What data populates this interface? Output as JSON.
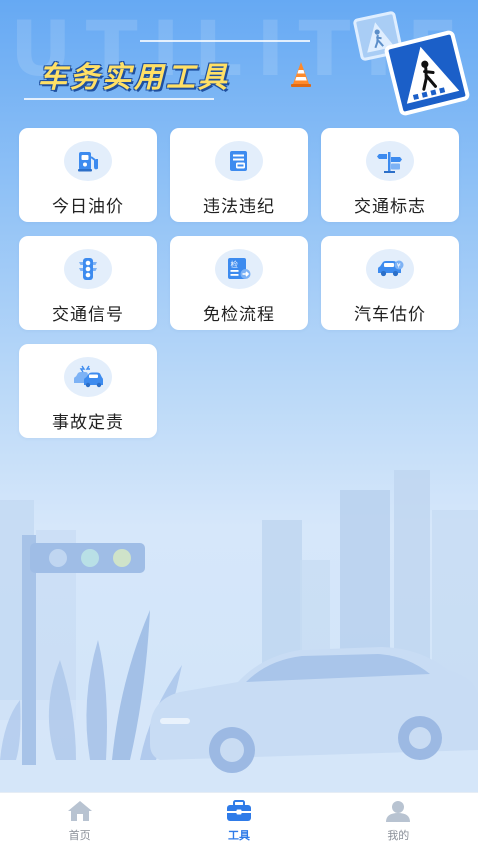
{
  "header": {
    "bg_text": "UTILITIES",
    "title": "车务实用工具"
  },
  "tools": [
    {
      "id": "oil",
      "label": "今日油价",
      "icon": "fuel-pump-icon"
    },
    {
      "id": "violation",
      "label": "违法违纪",
      "icon": "violation-doc-icon"
    },
    {
      "id": "signs",
      "label": "交通标志",
      "icon": "traffic-sign-icon"
    },
    {
      "id": "signal",
      "label": "交通信号",
      "icon": "traffic-light-icon"
    },
    {
      "id": "exempt",
      "label": "免检流程",
      "icon": "inspection-doc-icon"
    },
    {
      "id": "valuation",
      "label": "汽车估价",
      "icon": "car-price-icon"
    },
    {
      "id": "accident",
      "label": "事故定责",
      "icon": "car-accident-icon"
    }
  ],
  "tabbar": {
    "items": [
      {
        "label": "首页",
        "icon": "home-icon",
        "active": false
      },
      {
        "label": "工具",
        "icon": "toolbox-icon",
        "active": true
      },
      {
        "label": "我的",
        "icon": "user-icon",
        "active": false
      }
    ]
  },
  "colors": {
    "accent": "#2f7be8",
    "title_yellow": "#ffe066",
    "icon_blue": "#3d8bef",
    "icon_bg": "#e3eefb"
  }
}
